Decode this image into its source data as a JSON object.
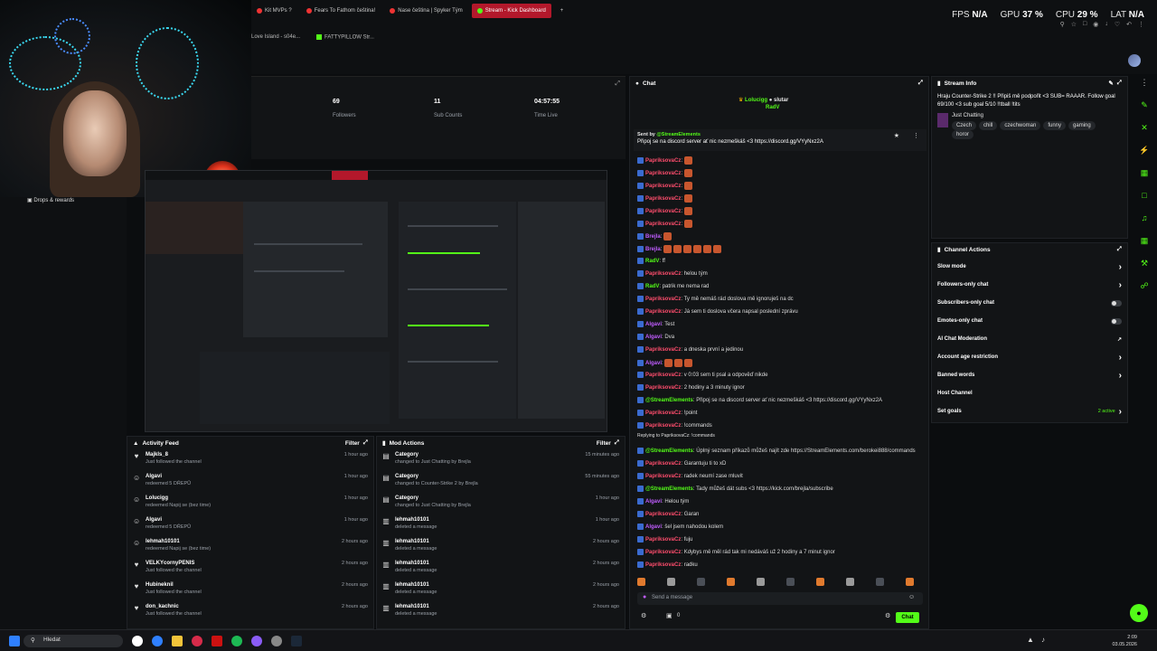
{
  "browser": {
    "tabs": [
      {
        "label": "Kit MVPs ?",
        "active": false
      },
      {
        "label": "Fears To Fathom čeština!",
        "active": false
      },
      {
        "label": "Nase čeština | Spyker Tým",
        "active": false
      },
      {
        "label": "Stream - Kick Dashboard",
        "active": true
      }
    ],
    "new_tab": "+",
    "bookmarks": [
      "Love Island - s04e...",
      "FATTYPILLOW Str..."
    ]
  },
  "perf": {
    "fps_label": "FPS",
    "fps_value": "N/A",
    "gpu_label": "GPU",
    "gpu_value": "37 %",
    "cpu_label": "CPU",
    "cpu_value": "29 %",
    "lat_label": "LAT",
    "lat_value": "N/A"
  },
  "sidebar": {
    "drops": "Drops & rewards"
  },
  "stats": [
    {
      "value": "69",
      "label": "Followers"
    },
    {
      "value": "11",
      "label": "Sub Counts"
    },
    {
      "value": "04:57:55",
      "label": "Time Live"
    }
  ],
  "activity": {
    "title": "Activity Feed",
    "filter": "Filter",
    "rows": [
      {
        "name": "Majkls_8",
        "desc": "Just followed the channel",
        "time": "1 hour ago",
        "icon": "heart"
      },
      {
        "name": "Algavi",
        "desc": "redeemed 5 DŘEPŮ",
        "time": "1 hour ago",
        "icon": "user"
      },
      {
        "name": "Lolucigg",
        "desc": "redeemed Napij se (bez time)",
        "time": "1 hour ago",
        "icon": "user"
      },
      {
        "name": "Algavi",
        "desc": "redeemed 5 DŘEPŮ",
        "time": "1 hour ago",
        "icon": "user"
      },
      {
        "name": "lehmah10101",
        "desc": "redeemed Napij se (bez time)",
        "time": "2 hours ago",
        "icon": "user"
      },
      {
        "name": "VELKYcornyPENIS",
        "desc": "Just followed the channel",
        "time": "2 hours ago",
        "icon": "heart"
      },
      {
        "name": "Hubineknil",
        "desc": "Just followed the channel",
        "time": "2 hours ago",
        "icon": "heart"
      },
      {
        "name": "don_kachnic",
        "desc": "Just followed the channel",
        "time": "2 hours ago",
        "icon": "heart"
      }
    ]
  },
  "modactions": {
    "title": "Mod Actions",
    "filter": "Filter",
    "rows": [
      {
        "name": "Category",
        "desc": "changed to Just Chatting by Brejla",
        "time": "15 minutes ago",
        "icon": "cat"
      },
      {
        "name": "Category",
        "desc": "changed to Counter-Strike 2 by Brejla",
        "time": "55 minutes ago",
        "icon": "cat"
      },
      {
        "name": "Category",
        "desc": "changed to Just Chatting by Brejla",
        "time": "1 hour ago",
        "icon": "cat"
      },
      {
        "name": "lehmah10101",
        "desc": "deleted a message",
        "time": "1 hour ago",
        "icon": "trash"
      },
      {
        "name": "lehmah10101",
        "desc": "deleted a message",
        "time": "2 hours ago",
        "icon": "trash"
      },
      {
        "name": "lehmah10101",
        "desc": "deleted a message",
        "time": "2 hours ago",
        "icon": "trash"
      },
      {
        "name": "lehmah10101",
        "desc": "deleted a message",
        "time": "2 hours ago",
        "icon": "trash"
      },
      {
        "name": "lehmah10101",
        "desc": "deleted a message",
        "time": "2 hours ago",
        "icon": "trash"
      }
    ]
  },
  "chat": {
    "title": "Chat",
    "top_users": [
      "Lolucigg",
      "slutar",
      "RadV"
    ],
    "pinned_by": "Sent by",
    "pinned_user": "@StreamElements",
    "pinned_text": "Připoj se na discord server ať nic nezmeškáš <3 https://discord.gg/VYyNxz2A",
    "messages": [
      {
        "user": "PapriksovaCz",
        "ucls": "u",
        "text": "",
        "em": 1
      },
      {
        "user": "PapriksovaCz",
        "ucls": "u",
        "text": "",
        "em": 1
      },
      {
        "user": "PapriksovaCz",
        "ucls": "u",
        "text": "",
        "em": 1
      },
      {
        "user": "PapriksovaCz",
        "ucls": "u",
        "text": "",
        "em": 1
      },
      {
        "user": "PapriksovaCz",
        "ucls": "u",
        "text": "",
        "em": 1
      },
      {
        "user": "PapriksovaCz",
        "ucls": "u",
        "text": "",
        "em": 1
      },
      {
        "user": "Brejla",
        "ucls": "up",
        "text": "",
        "em": 1
      },
      {
        "user": "Brejla",
        "ucls": "up",
        "text": "",
        "em": 6
      },
      {
        "user": "RadV",
        "ucls": "ug",
        "text": "ff",
        "em": 0
      },
      {
        "user": "PapriksovaCz",
        "ucls": "u",
        "text": "helou tým",
        "em": 0
      },
      {
        "user": "RadV",
        "ucls": "ug",
        "text": "patrik me nema rad",
        "em": 0
      },
      {
        "user": "PapriksovaCz",
        "ucls": "u",
        "text": "Ty mě nemáš rád doslova mě ignoruješ na dc",
        "em": 0
      },
      {
        "user": "PapriksovaCz",
        "ucls": "u",
        "text": "Já sem ti doslova včera napsal poslední zprávu",
        "em": 0
      },
      {
        "user": "Algavi",
        "ucls": "up",
        "text": "Test",
        "em": 0
      },
      {
        "user": "Algavi",
        "ucls": "up",
        "text": "Dva",
        "em": 0
      },
      {
        "user": "PapriksovaCz",
        "ucls": "u",
        "text": "a dneska první a jedinou",
        "em": 0
      },
      {
        "user": "Algavi",
        "ucls": "up",
        "text": "",
        "em": 3
      },
      {
        "user": "PapriksovaCz",
        "ucls": "u",
        "text": "v 0:03 sem ti psal a odpověď nikde",
        "em": 0
      },
      {
        "user": "PapriksovaCz",
        "ucls": "u",
        "text": "2 hodiny a 3 minuty ignor",
        "em": 0
      },
      {
        "user": "@StreamElements",
        "ucls": "ug",
        "text": "Připoj se na discord server ať nic nezmeškáš <3 https://discord.gg/VYyNxz2A",
        "em": 0
      },
      {
        "user": "PapriksovaCz",
        "ucls": "u",
        "text": "!point",
        "em": 0
      },
      {
        "user": "PapriksovaCz",
        "ucls": "u",
        "text": "!commands",
        "em": 0
      },
      {
        "user": "@StreamElements",
        "ucls": "ug",
        "text": "Úplný seznam příkazů můžeš najít zde https://StreamElements.com/berokei888/commands",
        "em": 0
      },
      {
        "user": "PapriksovaCz",
        "ucls": "u",
        "text": "Garantuju ti to xD",
        "em": 0
      },
      {
        "user": "PapriksovaCz",
        "ucls": "u",
        "text": "radek neumí zase mluvit",
        "em": 0
      },
      {
        "user": "@StreamElements",
        "ucls": "ug",
        "text": "Tady můžeš dát subs <3 https://kick.com/brejla/subscribe",
        "em": 0
      },
      {
        "user": "Algavi",
        "ucls": "up",
        "text": "Helou tým",
        "em": 0
      },
      {
        "user": "PapriksovaCz",
        "ucls": "u",
        "text": "Garan",
        "em": 0
      },
      {
        "user": "Algavi",
        "ucls": "up",
        "text": "šel jsem nahodou kolem",
        "em": 0
      },
      {
        "user": "PapriksovaCz",
        "ucls": "u",
        "text": "fuju",
        "em": 0
      },
      {
        "user": "PapriksovaCz",
        "ucls": "u",
        "text": "Kdybys mě měl rád tak mi nedáváš už 2 hodiny a 7 minut ignor",
        "em": 0
      },
      {
        "user": "PapriksovaCz",
        "ucls": "u",
        "text": "radku",
        "em": 0
      }
    ],
    "reply_note": "Replying to PapriksovaCz: !commands",
    "input_placeholder": "Send a message",
    "count": "0",
    "send": "Chat"
  },
  "streaminfo": {
    "title": "Stream Info",
    "text": "Hraju Counter-Strike 2 !! Připiš mě podpořit <3 SUB= RAAAR. Follow goal 69/100 <3 sub goal 5/10 !!tball !tits",
    "category": "Just Chatting",
    "tags": [
      "Czech",
      "chill",
      "czechwoman",
      "funny",
      "gaming",
      "horor"
    ]
  },
  "channelactions": {
    "title": "Channel Actions",
    "rows": [
      {
        "label": "Slow mode",
        "ctrl": "arrow"
      },
      {
        "label": "Followers-only chat",
        "ctrl": "arrow"
      },
      {
        "label": "Subscribers-only chat",
        "ctrl": "toggle"
      },
      {
        "label": "Emotes-only chat",
        "ctrl": "toggle"
      },
      {
        "label": "AI Chat Moderation",
        "ctrl": "ext"
      },
      {
        "label": "Account age restriction",
        "ctrl": "arrow"
      },
      {
        "label": "Banned words",
        "ctrl": "arrow"
      },
      {
        "label": "Host Channel",
        "ctrl": "none"
      },
      {
        "label": "Set goals",
        "ctrl": "goals",
        "note": "2 active"
      }
    ]
  },
  "taskbar": {
    "search": "Hledat",
    "time": "2:09",
    "date": "03.05.2026"
  },
  "colors": {
    "accent": "#53fc18",
    "live": "#b3182b",
    "bg": "#121416"
  }
}
